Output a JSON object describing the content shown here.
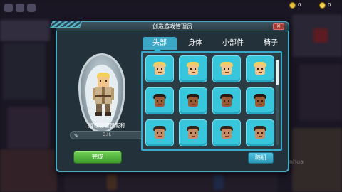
{
  "dialog": {
    "title": "创造游戏管理员",
    "close_label": "✕"
  },
  "avatar": {
    "name_label": "游戏管理员昵称",
    "name_value": "G.H.",
    "edit_icon": "✎"
  },
  "tabs": [
    {
      "label": "头部",
      "active": true
    },
    {
      "label": "身体",
      "active": false
    },
    {
      "label": "小部件",
      "active": false
    },
    {
      "label": "椅子",
      "active": false
    }
  ],
  "faces_grid": {
    "rows": [
      [
        {
          "skin": "#f2c48c",
          "hair": "#f0d05a"
        },
        {
          "skin": "#f2c48c",
          "hair": "#f0d05a"
        },
        {
          "skin": "#f2c48c",
          "hair": "#f0d05a"
        },
        {
          "skin": "#f2c48c",
          "hair": "#f0d05a"
        }
      ],
      [
        {
          "skin": "#9b5a36",
          "hair": "#2a1a12"
        },
        {
          "skin": "#9b5a36",
          "hair": "#2a1a12"
        },
        {
          "skin": "#9b5a36",
          "hair": "#2a1a12"
        },
        {
          "skin": "#9b5a36",
          "hair": "#2a1a12"
        }
      ],
      [
        {
          "skin": "#c78a62",
          "hair": "#3a2418"
        },
        {
          "skin": "#c78a62",
          "hair": "#3a2418"
        },
        {
          "skin": "#c78a62",
          "hair": "#3a2418"
        },
        {
          "skin": "#c78a62",
          "hair": "#3a2418"
        }
      ]
    ]
  },
  "buttons": {
    "done": "完成",
    "random": "随机"
  },
  "hud": {
    "coins": "0",
    "gems": "0"
  },
  "colors": {
    "accent": "#38a9ca",
    "cell": "#38c6dc",
    "done_green": "#4bb53a"
  },
  "watermark": "nhua"
}
